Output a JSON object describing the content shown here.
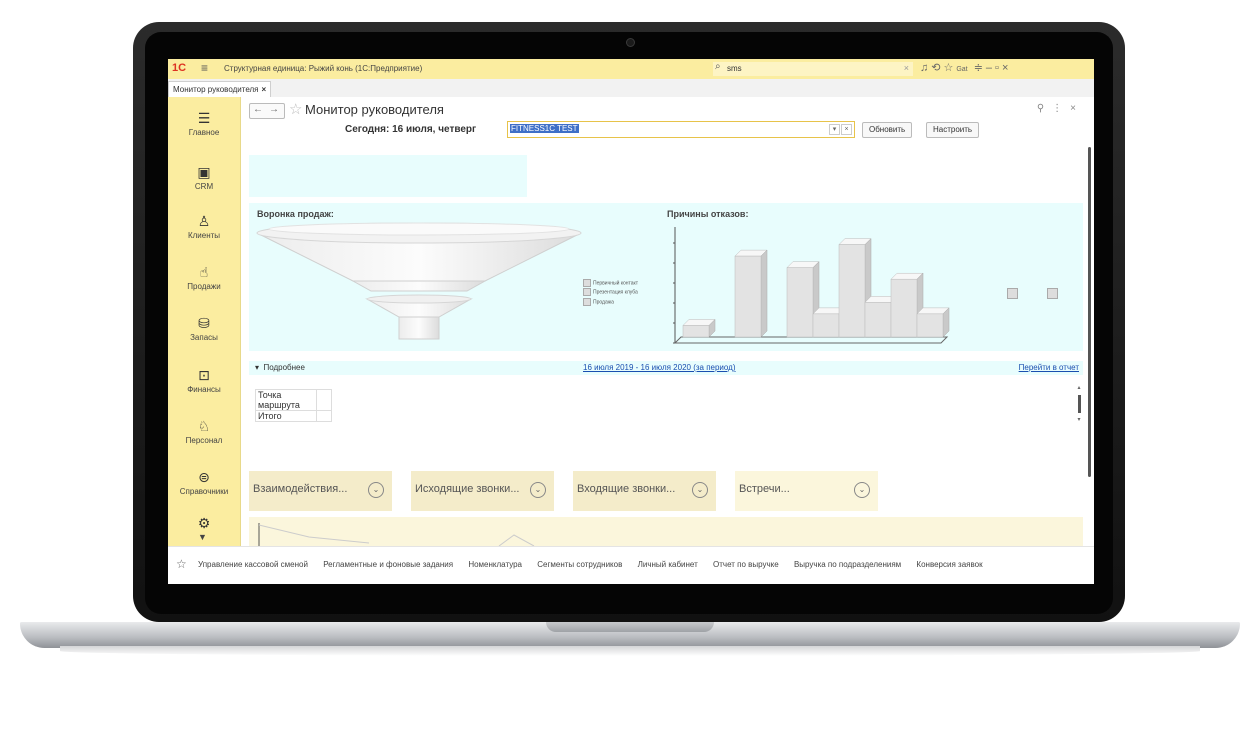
{
  "titlebar": {
    "logo": "1С",
    "title": "Структурная единица: Рыжий конь  (1С:Предприятие)",
    "search_value": "sms",
    "user_label": "Gat"
  },
  "tabs": [
    {
      "label": "Монитор руководителя",
      "close": "×"
    }
  ],
  "sidebar": {
    "items": [
      {
        "label": "Главное",
        "icon": "menu-icon"
      },
      {
        "label": "CRM",
        "icon": "contact-card-icon"
      },
      {
        "label": "Клиенты",
        "icon": "clients-icon"
      },
      {
        "label": "Продажи",
        "icon": "sales-icon"
      },
      {
        "label": "Запасы",
        "icon": "stock-icon"
      },
      {
        "label": "Финансы",
        "icon": "finance-icon"
      },
      {
        "label": "Персонал",
        "icon": "staff-icon"
      },
      {
        "label": "Справочники",
        "icon": "catalogs-icon"
      }
    ]
  },
  "header": {
    "title": "Монитор руководителя",
    "today_label": "Сегодня:  16 июля, четверг",
    "org_value": "FITNESS1C TEST",
    "refresh_label": "Обновить",
    "configure_label": "Настроить"
  },
  "funnel": {
    "title": "Воронка продаж:",
    "legend": [
      "Первичный контакт",
      "Презентация клуба",
      "Продажа"
    ]
  },
  "reasons": {
    "title": "Причины отказов:"
  },
  "chart_data": {
    "type": "bar",
    "title": "Причины отказов:",
    "series": [
      {
        "values": [
          1,
          7,
          6,
          8,
          5
        ]
      },
      {
        "values": [
          0,
          0,
          2,
          3,
          2
        ]
      }
    ],
    "ylim": [
      0,
      9
    ]
  },
  "details": {
    "toggle_label": "Подробнее",
    "period_link": "16 июля 2019 - 16 июля 2020 (за период)",
    "report_link": "Перейти в отчет"
  },
  "route_table": {
    "rows": [
      "Точка маршрута",
      "Итого"
    ]
  },
  "tiles": [
    {
      "label": "Взаимодействия..."
    },
    {
      "label": "Исходящие звонки..."
    },
    {
      "label": "Входящие звонки..."
    },
    {
      "label": "Встречи..."
    }
  ],
  "bottom_links": [
    "Управление кассовой сменой",
    "Регламентные и фоновые задания",
    "Номенклатура",
    "Сегменты сотрудников",
    "Личный кабинет",
    "Отчет по выручке",
    "Выручка по подразделениям",
    "Конверсия заявок"
  ]
}
